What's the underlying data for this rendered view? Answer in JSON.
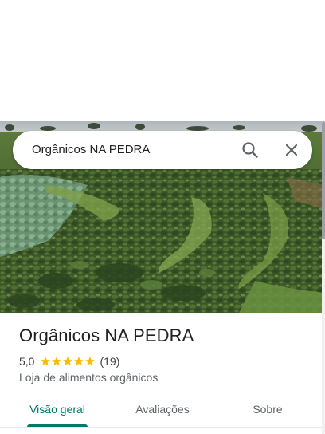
{
  "search": {
    "query": "Orgânicos NA PEDRA",
    "search_icon": "search-icon",
    "close_icon": "close-icon"
  },
  "hero": {
    "image": "photo of an organic vegetable field with rows of crops and trees on the horizon"
  },
  "place": {
    "name": "Orgânicos NA PEDRA",
    "rating": "5,0",
    "stars": 5,
    "review_count": "(19)",
    "category": "Loja de alimentos orgânicos"
  },
  "tabs": [
    {
      "label": "Visão geral",
      "active": true
    },
    {
      "label": "Avaliações",
      "active": false
    },
    {
      "label": "Sobre",
      "active": false
    }
  ],
  "colors": {
    "accent": "#00796b",
    "star": "#fbbc04",
    "text_primary": "#202124",
    "text_secondary": "#5f6368"
  }
}
